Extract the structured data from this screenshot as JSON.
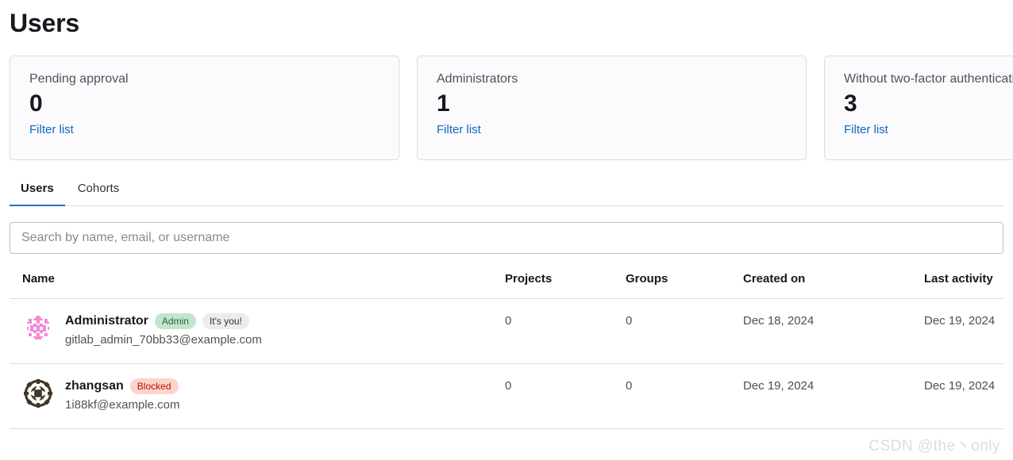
{
  "page": {
    "title": "Users"
  },
  "stat_cards": [
    {
      "title": "Pending approval",
      "value": "0",
      "link_label": "Filter list"
    },
    {
      "title": "Administrators",
      "value": "1",
      "link_label": "Filter list"
    },
    {
      "title": "Without two-factor authentication",
      "value": "3",
      "link_label": "Filter list"
    }
  ],
  "tabs": [
    {
      "label": "Users",
      "active": true
    },
    {
      "label": "Cohorts",
      "active": false
    }
  ],
  "search": {
    "placeholder": "Search by name, email, or username",
    "value": ""
  },
  "table": {
    "headers": {
      "name": "Name",
      "projects": "Projects",
      "groups": "Groups",
      "created_on": "Created on",
      "last_activity": "Last activity"
    },
    "rows": [
      {
        "name": "Administrator",
        "email": "gitlab_admin_70bb33@example.com",
        "badges": [
          {
            "label": "Admin",
            "kind": "admin"
          },
          {
            "label": "It's you!",
            "kind": "you"
          }
        ],
        "projects": "0",
        "groups": "0",
        "created_on": "Dec 18, 2024",
        "last_activity": "Dec 19, 2024",
        "avatar_color": "#f489d8"
      },
      {
        "name": "zhangsan",
        "email": "1i88kf@example.com",
        "badges": [
          {
            "label": "Blocked",
            "kind": "blocked"
          }
        ],
        "projects": "0",
        "groups": "0",
        "created_on": "Dec 19, 2024",
        "last_activity": "Dec 19, 2024",
        "avatar_color": "#40362a"
      }
    ]
  },
  "watermark": {
    "text": "CSDN @the丶only"
  },
  "colors": {
    "accent": "#1f75cb",
    "link": "#1068bf",
    "badge_admin_bg": "#c3e6cb",
    "badge_you_bg": "#ececef",
    "badge_blocked_bg": "#fdd4cd",
    "border": "#dcdcde"
  }
}
